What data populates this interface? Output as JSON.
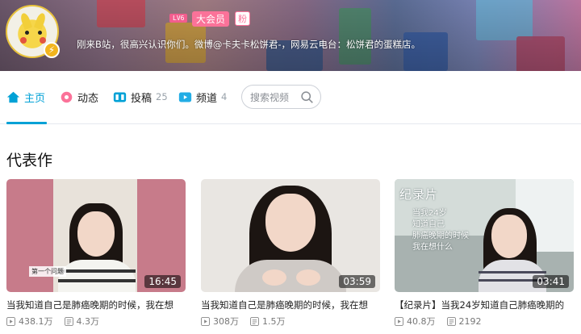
{
  "profile": {
    "level": "LV6",
    "vip_label": "大会员",
    "fan_label": "粉",
    "signature": "刚来B站，很高兴认识你们。微博@卡夫卡松饼君-，网易云电台：松饼君的蛋糕店。"
  },
  "nav": {
    "home": "主页",
    "dynamic": "动态",
    "posts": "投稿",
    "posts_count": "25",
    "channels": "频道",
    "channels_count": "4",
    "search_placeholder": "搜索视频"
  },
  "section": {
    "title": "代表作"
  },
  "videos": [
    {
      "duration": "16:45",
      "title": "当我知道自己是肺癌晚期的时候，我在想",
      "views": "438.1万",
      "danmaku": "4.3万",
      "caption": "第一个问题"
    },
    {
      "duration": "03:59",
      "title": "当我知道自己是肺癌晚期的时候，我在想",
      "views": "308万",
      "danmaku": "1.5万"
    },
    {
      "duration": "03:41",
      "title": "【纪录片】当我24岁知道自己肺癌晚期的",
      "views": "40.8万",
      "danmaku": "2192",
      "overlay_title": "纪录片",
      "overlay_lines": [
        "当我24岁",
        "知道自己",
        "肺癌晚期的时候",
        "我在想什么"
      ]
    }
  ],
  "colors": {
    "accent": "#00a1d6",
    "pink": "#fb7299"
  },
  "icons": {
    "home": "home-icon",
    "dynamic": "flower-icon",
    "posts": "video-post-icon",
    "channels": "channel-icon",
    "search": "search-icon",
    "views": "play-count-icon",
    "danmaku": "danmaku-icon"
  }
}
